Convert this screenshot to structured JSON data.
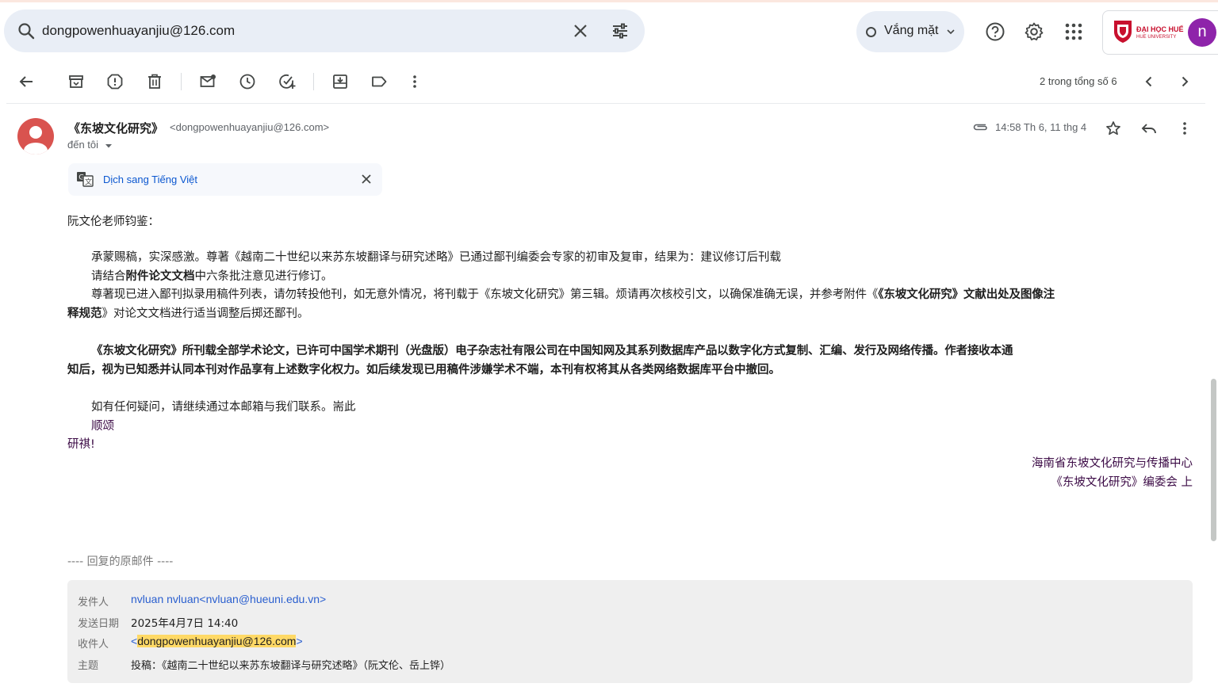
{
  "search": {
    "query": "dongpowenhuayanjiu@126.com"
  },
  "header": {
    "status_label": "Vắng mặt",
    "university_name": "ĐẠI HỌC HUẾ",
    "university_sub": "HUE UNIVERSITY",
    "avatar_letter": "n"
  },
  "toolbar": {
    "pager": "2 trong tổng số 6"
  },
  "message": {
    "sender_name": "《东坡文化研究》",
    "sender_email": "<dongpowenhuayanjiu@126.com>",
    "to": "đến tôi",
    "timestamp": "14:58 Th 6, 11 thg 4",
    "translate_label": "Dịch sang Tiếng Việt",
    "body": {
      "greeting": "阮文伦老师钧鉴：",
      "p1": "承蒙赐稿，实深感激。尊著《越南二十世纪以来苏东坡翻译与研究述略》已通过鄙刊编委会专家的初审及复审，结果为：建议修订后刊载",
      "p2_a": "请结合",
      "p2_b": "附件论文文档",
      "p2_c": "中六条批注意见进行修订。",
      "p3_a": "尊著现已进入鄙刊拟录用稿件列表，请勿转投他刊，如无意外情况，将刊载于《东坡文化研究》第三辑。烦请再次核校引文，以确保准确无误，并参考附件《",
      "p3_b": "《东坡文化研究》文献出处及图像注",
      "p3_c": "释规范",
      "p3_d": "》对论文文档进行适当调整后掷还鄙刊。",
      "p4_l1": "《东坡文化研究》所刊载全部学术论文，已许可中国学术期刊（光盘版）电子杂志社有限公司在中国知网及其系列数据库产品以数字化方式复制、汇编、发行及网络传播。作者接收本通",
      "p4_l2": "知后，视为已知悉并认同本刊对作品享有上述数字化权力。如后续发现已用稿件涉嫌学术不端，本刊有权将其从各类网络数据库平台中撤回。",
      "p5": "如有任何疑问，请继续通过本邮箱与我们联系。耑此",
      "closing1": "顺颂",
      "closing2": "研祺!",
      "sign1": "海南省东坡文化研究与传播中心",
      "sign2": "《东坡文化研究》编委会  上"
    },
    "quoted": {
      "header": "---- 回复的原邮件 ----",
      "from_label": "发件人",
      "from_value": "nvluan nvluan<nvluan@hueuni.edu.vn>",
      "date_label": "发送日期",
      "date_value": "2025年4月7日 14:40",
      "to_label": "收件人",
      "to_open": "<",
      "to_value": "dongpowenhuayanjiu@126.com",
      "to_close": ">",
      "subject_label": "主题",
      "subject_value": "投稿：《越南二十世纪以来苏东坡翻译与研究述略》（阮文伦、岳上铧）"
    }
  }
}
